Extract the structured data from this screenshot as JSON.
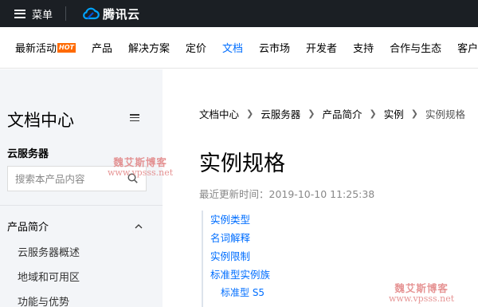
{
  "topbar": {
    "menu_label": "菜单",
    "brand_name": "腾讯云"
  },
  "nav": {
    "items": [
      {
        "label": "最新活动",
        "badge": "HOT"
      },
      {
        "label": "产品"
      },
      {
        "label": "解决方案"
      },
      {
        "label": "定价"
      },
      {
        "label": "文档",
        "active": true
      },
      {
        "label": "云市场"
      },
      {
        "label": "开发者"
      },
      {
        "label": "支持"
      },
      {
        "label": "合作与生态"
      },
      {
        "label": "客户"
      }
    ]
  },
  "sidebar": {
    "title": "文档中心",
    "product": "云服务器",
    "search_placeholder": "搜索本产品内容",
    "section": "产品简介",
    "items": [
      "云服务器概述",
      "地域和可用区",
      "功能与优势"
    ]
  },
  "breadcrumb": [
    "文档中心",
    "云服务器",
    "产品简介",
    "实例",
    "实例规格"
  ],
  "page": {
    "title": "实例规格",
    "updated": "最近更新时间：2019-10-10 11:25:38"
  },
  "toc": [
    "实例类型",
    "名词解释",
    "实例限制",
    "标准型实例族",
    "标准型 S5"
  ],
  "watermark": {
    "name": "魏艾斯博客",
    "url": "www.vpsss.net"
  },
  "colors": {
    "accent": "#006eff",
    "topbar_bg": "#1b1f24",
    "sidebar_bg": "#f3f5f8",
    "hot_badge": "#ff6a00"
  }
}
